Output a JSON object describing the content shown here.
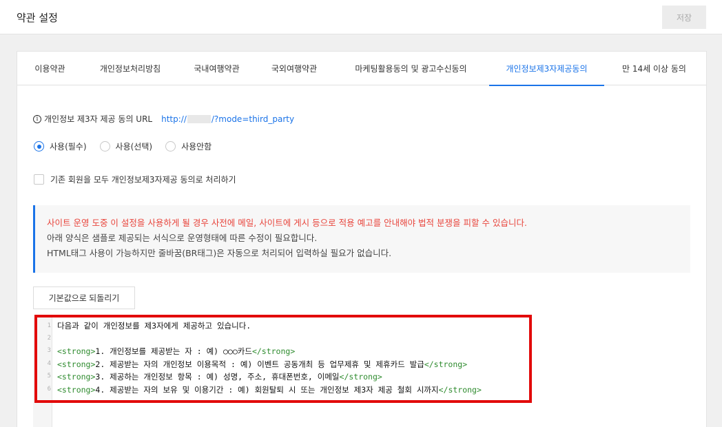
{
  "header": {
    "title": "약관 설정",
    "save_label": "저장"
  },
  "tabs": [
    {
      "label": "이용약관"
    },
    {
      "label": "개인정보처리방침"
    },
    {
      "label": "국내여행약관"
    },
    {
      "label": "국외여행약관"
    },
    {
      "label": "마케팅활용동의 및 광고수신동의"
    },
    {
      "label": "개인정보제3자제공동의"
    },
    {
      "label": "만 14세 이상 동의"
    }
  ],
  "url_row": {
    "label": "개인정보 제3자 제공 동의 URL",
    "url_prefix": "http://",
    "url_suffix": "/?mode=third_party"
  },
  "radios": [
    {
      "label": "사용(필수)",
      "checked": true
    },
    {
      "label": "사용(선택)",
      "checked": false
    },
    {
      "label": "사용안함",
      "checked": false
    }
  ],
  "checkbox": {
    "label": "기존 회원을 모두 개인정보제3자제공 동의로 처리하기"
  },
  "notice": {
    "warning": "사이트 운영 도중 이 설정을 사용하게 될 경우 사전에 메일, 사이트에 게시 등으로 적용 예고를 안내해야 법적 분쟁을 피할 수 있습니다.",
    "line2": "아래 양식은 샘플로 제공되는 서식으로 운영형태에 따른 수정이 필요합니다.",
    "line3": "HTML태그 사용이 가능하지만 줄바꿈(BR태그)은 자동으로 처리되어 입력하실 필요가 없습니다."
  },
  "reset_label": "기본값으로 되돌리기",
  "editor": {
    "line_numbers": [
      "1",
      "2",
      "3",
      "4",
      "5",
      "6"
    ],
    "open_tag": "<strong>",
    "close_tag": "</strong>",
    "line1": "다음과 같이 개인정보를 제3자에게 제공하고 있습니다.",
    "item1": "1. 개인정보를 제공받는 자 : 예) ○○○카드",
    "item2": "2. 제공받는 자의 개인정보 이용목적 : 예) 이벤트 공동개최 등 업무제휴 및 제휴카드 발급",
    "item3": "3. 제공하는 개인정보 항목 : 예) 성명, 주소, 휴대폰번호, 이메일",
    "item4": "4. 제공받는 자의 보유 및 이용기간 : 예) 회원탈퇴 시 또는 개인정보 제3자 제공 철회 시까지"
  },
  "colors": {
    "accent": "#1a73e8",
    "warning": "#e8453c",
    "tag": "#2e8b2e",
    "highlight": "#e20a0a"
  }
}
